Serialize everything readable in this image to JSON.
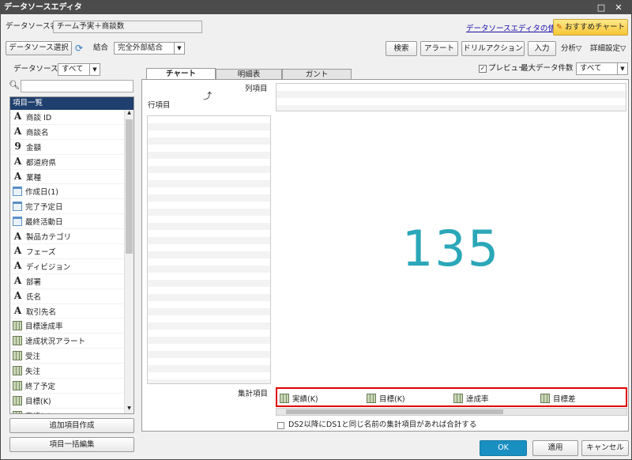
{
  "window": {
    "title": "データソースエディタ",
    "minimize": "□",
    "close": "✕"
  },
  "header": {
    "ds_name_label": "データソース名",
    "ds_name_value": "チーム予実＋商談数",
    "help_link": "データソースエディタの使い方",
    "recommend_button": "おすすめチャート"
  },
  "toolbar": {
    "ds_select": "データソース選択",
    "join_label": "結合",
    "join_value": "完全外部結合",
    "search": "検索",
    "alert": "アラート",
    "drill": "ドリルアクション",
    "input": "入力",
    "analysis": "分析▽",
    "detail": "詳細設定▽"
  },
  "left": {
    "ds_label": "データソース",
    "ds_filter": "すべて",
    "list_header": "項目一覧",
    "items": [
      {
        "icon": "text",
        "label": "商談 ID"
      },
      {
        "icon": "text",
        "label": "商談名"
      },
      {
        "icon": "number",
        "label": "金額"
      },
      {
        "icon": "text",
        "label": "都道府県"
      },
      {
        "icon": "text",
        "label": "業種"
      },
      {
        "icon": "date",
        "label": "作成日(1)"
      },
      {
        "icon": "date",
        "label": "完了予定日"
      },
      {
        "icon": "date",
        "label": "最終活動日"
      },
      {
        "icon": "text",
        "label": "製品カテゴリ"
      },
      {
        "icon": "text",
        "label": "フェーズ"
      },
      {
        "icon": "text",
        "label": "ディビジョン"
      },
      {
        "icon": "text",
        "label": "部署"
      },
      {
        "icon": "text",
        "label": "氏名"
      },
      {
        "icon": "text",
        "label": "取引先名"
      },
      {
        "icon": "calc",
        "label": "目標達成率"
      },
      {
        "icon": "calc",
        "label": "達成状況アラート"
      },
      {
        "icon": "calc",
        "label": "受注"
      },
      {
        "icon": "calc",
        "label": "失注"
      },
      {
        "icon": "calc",
        "label": "終了予定"
      },
      {
        "icon": "calc",
        "label": "目標(K)"
      },
      {
        "icon": "calc",
        "label": "実績(K)"
      }
    ],
    "add_button": "追加項目作成",
    "bulk_button": "項目一括編集"
  },
  "tabs": [
    "チャート",
    "明細表",
    "ガント"
  ],
  "preview": {
    "label": "プレビュー",
    "max_label": "最大データ件数",
    "max_value": "すべて"
  },
  "chart": {
    "col_label": "列項目",
    "row_label": "行項目",
    "sum_label": "集計項目",
    "value": "135",
    "sum_items": [
      "実績(K)",
      "目標(K)",
      "達成率",
      "目標差"
    ],
    "ds_checkbox": "DS2以降にDS1と同じ名前の集計項目があれば合計する"
  },
  "footer": {
    "ok": "OK",
    "apply": "適用",
    "cancel": "キャンセル"
  },
  "colors": {
    "accent": "#1a8fc2",
    "value": "#2aa7b8",
    "highlight": "#e00000"
  }
}
